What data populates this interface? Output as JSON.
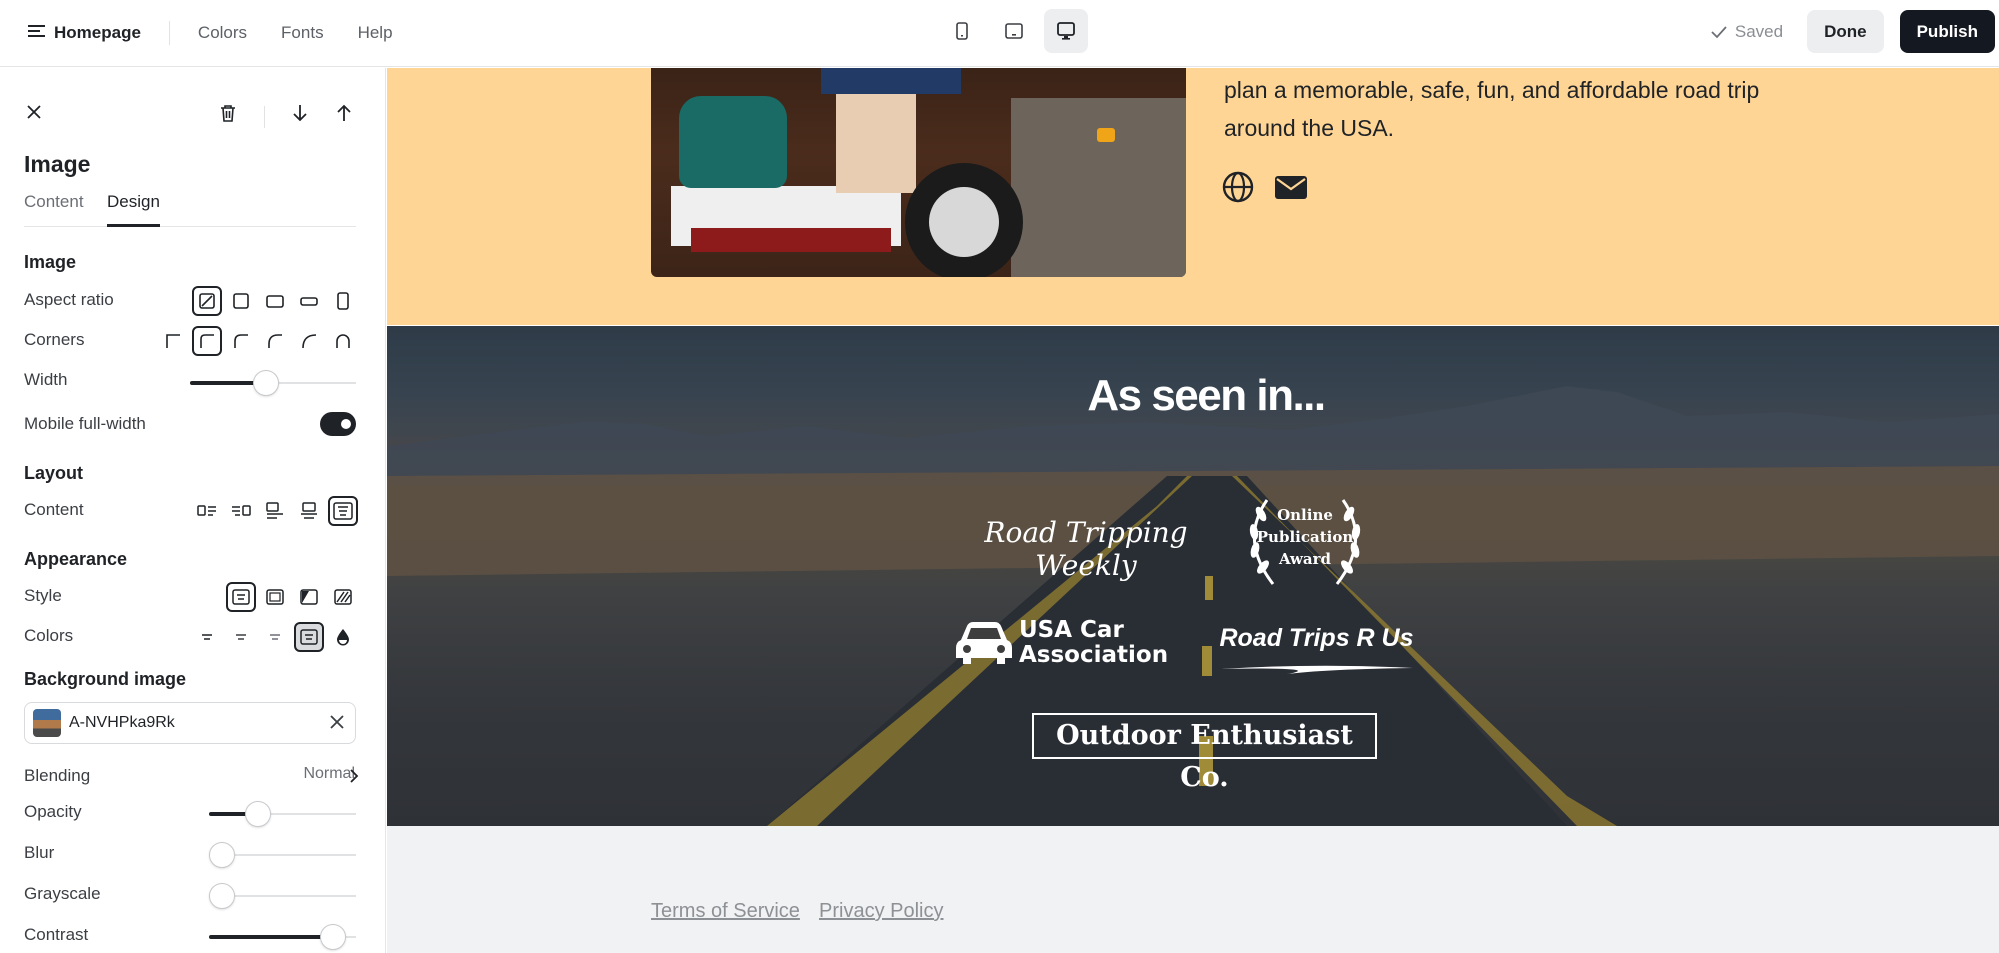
{
  "topbar": {
    "home_label": "Homepage",
    "nav": [
      "Colors",
      "Fonts",
      "Help"
    ],
    "saved_label": "Saved",
    "done_label": "Done",
    "publish_label": "Publish"
  },
  "sidebar": {
    "title": "Image",
    "tabs": [
      "Content",
      "Design"
    ],
    "active_tab": "Design",
    "sections": {
      "image": "Image",
      "layout": "Layout",
      "appearance": "Appearance",
      "background_image": "Background image"
    },
    "labels": {
      "aspect_ratio": "Aspect ratio",
      "corners": "Corners",
      "width": "Width",
      "mobile_full_width": "Mobile full-width",
      "content": "Content",
      "style": "Style",
      "colors": "Colors",
      "blending": "Blending",
      "opacity": "Opacity",
      "blur": "Blur",
      "grayscale": "Grayscale",
      "contrast": "Contrast"
    },
    "mobile_full_width_on": true,
    "background_image_name": "A-NVHPka9Rk",
    "blending_value": "Normal",
    "sliders": {
      "width": 0.45,
      "opacity": 0.3,
      "blur": 0.0,
      "grayscale": 0.0,
      "contrast": 0.92
    }
  },
  "canvas": {
    "intro_text": "plan a memorable, safe, fun, and affordable road trip around the USA.",
    "press_heading": "As seen in...",
    "logos": {
      "road_tripping_weekly": "Road Tripping Weekly",
      "online_publication_award": [
        "Online",
        "Publication",
        "Award"
      ],
      "usa_car_association": "USA Car\nAssociation",
      "road_trips_r_us": "Road Trips R Us",
      "outdoor_enthusiast": "Outdoor Enthusiast Co."
    },
    "footer_links": [
      "Terms of Service",
      "Privacy Policy"
    ]
  },
  "colors": {
    "peach_section": "#fed595",
    "publish_button": "#141821",
    "footer_bg": "#f1f2f3"
  }
}
